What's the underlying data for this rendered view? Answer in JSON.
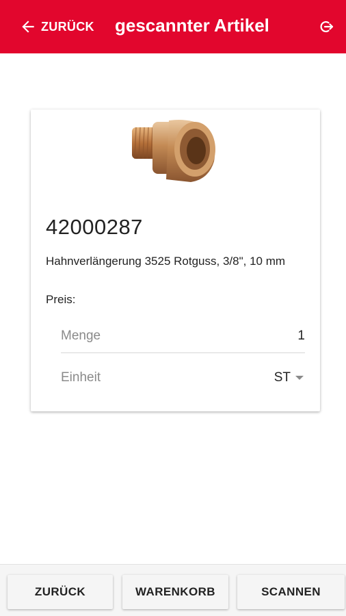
{
  "colors": {
    "brand": "#e2062d",
    "text": "#222222",
    "muted": "#8a8a8a"
  },
  "header": {
    "back_label": "ZURÜCK",
    "title": "gescannter Artikel",
    "back_icon": "arrow-left-icon",
    "logout_icon": "logout-icon"
  },
  "article": {
    "image": "product-fitting-image",
    "number": "42000287",
    "description": "Hahnverlängerung 3525 Rotguss, 3/8\", 10 mm",
    "price_label": "Preis:",
    "quantity_label": "Menge",
    "quantity_value": "1",
    "unit_label": "Einheit",
    "unit_value": "ST"
  },
  "footer": {
    "buttons": [
      {
        "label": "ZURÜCK"
      },
      {
        "label": "WARENKORB"
      },
      {
        "label": "SCANNEN"
      }
    ]
  }
}
